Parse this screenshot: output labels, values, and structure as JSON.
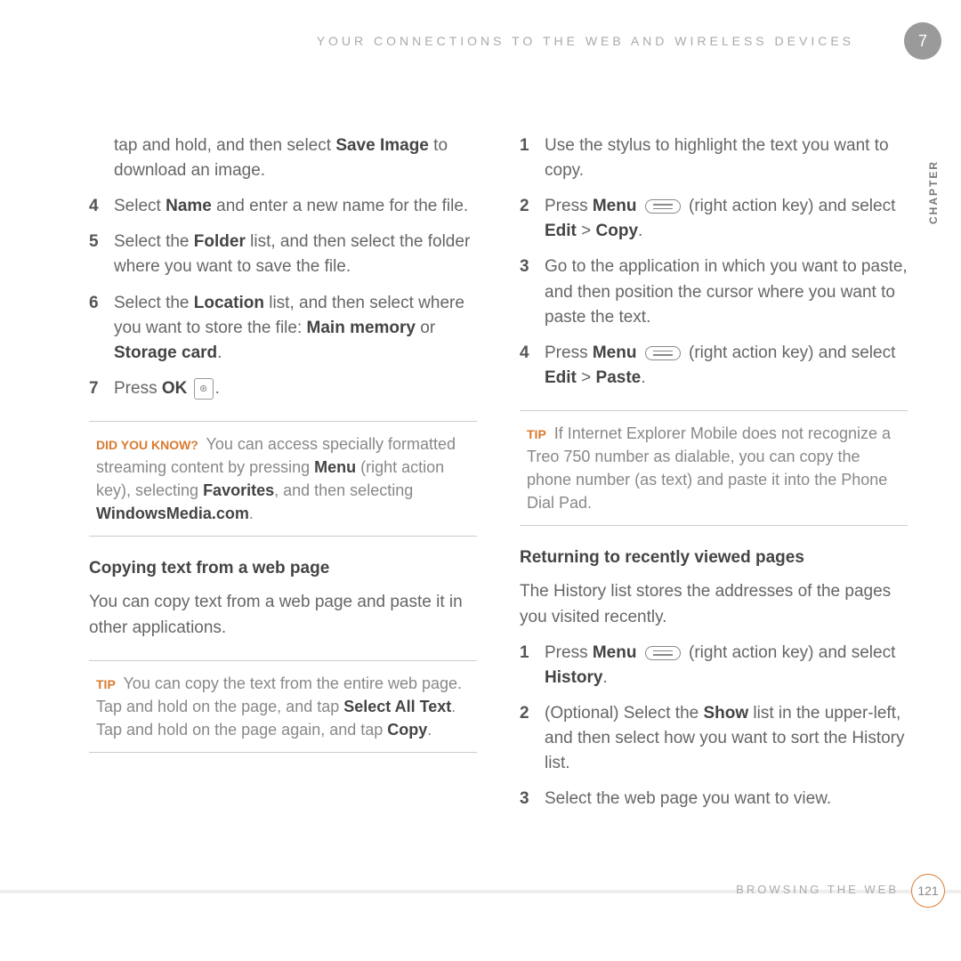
{
  "header": {
    "running_title": "YOUR CONNECTIONS TO THE WEB AND WIRELESS DEVICES",
    "chapter_number": "7",
    "chapter_label": "CHAPTER"
  },
  "left_column": {
    "continuation": {
      "pre": "tap and hold, and then select ",
      "bold1": "Save Image",
      "post": " to download an image."
    },
    "steps": [
      {
        "num": "4",
        "parts": [
          "Select ",
          {
            "b": "Name"
          },
          " and enter a new name for the file."
        ]
      },
      {
        "num": "5",
        "parts": [
          "Select the ",
          {
            "b": "Folder"
          },
          " list, and then select the folder where you want to save the file."
        ]
      },
      {
        "num": "6",
        "parts": [
          "Select the ",
          {
            "b": "Location"
          },
          " list, and then select where you want to store the file: ",
          {
            "b": "Main memory"
          },
          " or ",
          {
            "b": "Storage card"
          },
          "."
        ]
      },
      {
        "num": "7",
        "parts": [
          "Press ",
          {
            "b": "OK"
          },
          " ",
          {
            "icon": "ok"
          },
          "."
        ]
      }
    ],
    "callout1": {
      "label": "DID YOU KNOW?",
      "parts": [
        " You can access specially formatted streaming content by pressing ",
        {
          "b": "Menu"
        },
        " (right action key), selecting ",
        {
          "b": "Favorites"
        },
        ", and then selecting ",
        {
          "b": "WindowsMedia.com"
        },
        "."
      ]
    },
    "heading1": "Copying text from a web page",
    "para1": "You can copy text from a web page and paste it in other applications.",
    "callout2": {
      "label": "TIP",
      "parts": [
        " You can copy the text from the entire web page. Tap and hold on the page, and tap ",
        {
          "b": "Select All Text"
        },
        ". Tap and hold on the page again, and tap ",
        {
          "b": "Copy"
        },
        "."
      ]
    }
  },
  "right_column": {
    "steps1": [
      {
        "num": "1",
        "parts": [
          "Use the stylus to highlight the text you want to copy."
        ]
      },
      {
        "num": "2",
        "parts": [
          "Press ",
          {
            "b": "Menu"
          },
          " ",
          {
            "icon": "menu"
          },
          " (right action key) and select ",
          {
            "b": "Edit"
          },
          " > ",
          {
            "b": "Copy"
          },
          "."
        ]
      },
      {
        "num": "3",
        "parts": [
          "Go to the application in which you want to paste, and then position the cursor where you want to paste the text."
        ]
      },
      {
        "num": "4",
        "parts": [
          "Press ",
          {
            "b": "Menu"
          },
          " ",
          {
            "icon": "menu"
          },
          " (right action key) and select ",
          {
            "b": "Edit"
          },
          " > ",
          {
            "b": "Paste"
          },
          "."
        ]
      }
    ],
    "callout1": {
      "label": "TIP",
      "text": " If Internet Explorer Mobile does not recognize a Treo 750 number as dialable, you can copy the phone number (as text) and paste it into the Phone Dial Pad."
    },
    "heading1": "Returning to recently viewed pages",
    "para1": "The History list stores the addresses of the pages you visited recently.",
    "steps2": [
      {
        "num": "1",
        "parts": [
          "Press ",
          {
            "b": "Menu"
          },
          " ",
          {
            "icon": "menu"
          },
          " (right action key) and select ",
          {
            "b": "History"
          },
          "."
        ]
      },
      {
        "num": "2",
        "parts": [
          "(Optional) Select the ",
          {
            "b": "Show"
          },
          " list in the upper-left, and then select how you want to sort the History list."
        ]
      },
      {
        "num": "3",
        "parts": [
          "Select the web page you want to view."
        ]
      }
    ]
  },
  "footer": {
    "section": "BROWSING THE WEB",
    "page": "121"
  }
}
